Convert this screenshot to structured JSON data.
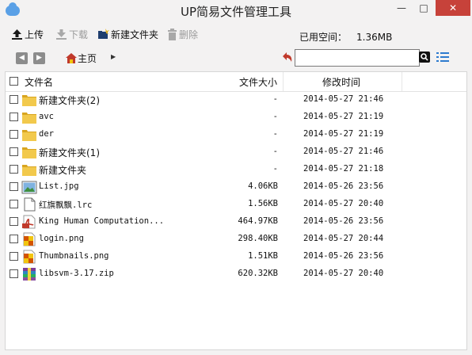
{
  "window": {
    "title": "UP简易文件管理工具",
    "minimize_glyph": "—",
    "maximize_glyph": "□",
    "close_glyph": "✕"
  },
  "toolbar": {
    "upload_label": "上传",
    "download_label": "下载",
    "new_folder_label": "新建文件夹",
    "delete_label": "删除",
    "used_space_label": "已用空间：",
    "used_space_value": "1.36MB"
  },
  "nav": {
    "back_glyph": "◀",
    "forward_glyph": "▶",
    "home_label": "主页",
    "crumb_arrow": "▶",
    "search_value": "",
    "search_placeholder": ""
  },
  "columns": {
    "name": "文件名",
    "size": "文件大小",
    "modified": "修改时间"
  },
  "files": [
    {
      "name": "新建文件夹(2)",
      "size": "-",
      "modified": "2014-05-27 21:46",
      "icon": "folder-icon"
    },
    {
      "name": "avc",
      "size": "-",
      "modified": "2014-05-27 21:19",
      "icon": "folder-icon"
    },
    {
      "name": "der",
      "size": "-",
      "modified": "2014-05-27 21:19",
      "icon": "folder-icon"
    },
    {
      "name": "新建文件夹(1)",
      "size": "-",
      "modified": "2014-05-27 21:46",
      "icon": "folder-icon"
    },
    {
      "name": "新建文件夹",
      "size": "-",
      "modified": "2014-05-27 21:18",
      "icon": "folder-icon"
    },
    {
      "name": "List.jpg",
      "size": "4.06KB",
      "modified": "2014-05-26 23:56",
      "icon": "image-icon"
    },
    {
      "name": "红旗飘飘.lrc",
      "size": "1.56KB",
      "modified": "2014-05-27 20:40",
      "icon": "text-file-icon"
    },
    {
      "name": "King Human Computation...",
      "size": "464.97KB",
      "modified": "2014-05-26 23:56",
      "icon": "pdf-icon"
    },
    {
      "name": "login.png",
      "size": "298.40KB",
      "modified": "2014-05-27 20:44",
      "icon": "png-icon"
    },
    {
      "name": "Thumbnails.png",
      "size": "1.51KB",
      "modified": "2014-05-26 23:56",
      "icon": "png-icon"
    },
    {
      "name": "libsvm-3.17.zip",
      "size": "620.32KB",
      "modified": "2014-05-27 20:40",
      "icon": "zip-icon"
    }
  ],
  "colors": {
    "close_button": "#c7423a",
    "folder": "#e8b93a",
    "pdf": "#c0392b"
  }
}
